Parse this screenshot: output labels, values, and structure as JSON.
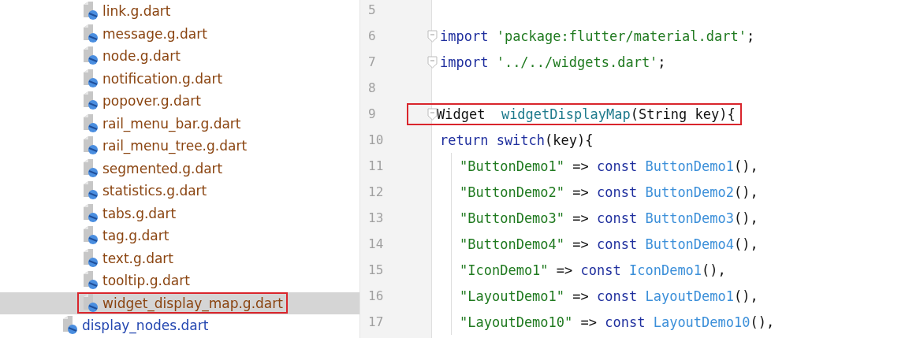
{
  "project_tree": [
    {
      "children": [
        {
          "label": "link.g.dart",
          "kind": "generated",
          "selected": false
        },
        {
          "label": "message.g.dart",
          "kind": "generated",
          "selected": false
        },
        {
          "label": "node.g.dart",
          "kind": "generated",
          "selected": false
        },
        {
          "label": "notification.g.dart",
          "kind": "generated",
          "selected": false
        },
        {
          "label": "popover.g.dart",
          "kind": "generated",
          "selected": false
        },
        {
          "label": "rail_menu_bar.g.dart",
          "kind": "generated",
          "selected": false
        },
        {
          "label": "rail_menu_tree.g.dart",
          "kind": "generated",
          "selected": false
        },
        {
          "label": "segmented.g.dart",
          "kind": "generated",
          "selected": false
        },
        {
          "label": "statistics.g.dart",
          "kind": "generated",
          "selected": false
        },
        {
          "label": "tabs.g.dart",
          "kind": "generated",
          "selected": false
        },
        {
          "label": "tag.g.dart",
          "kind": "generated",
          "selected": false
        },
        {
          "label": "text.g.dart",
          "kind": "generated",
          "selected": false
        },
        {
          "label": "tooltip.g.dart",
          "kind": "generated",
          "selected": false
        },
        {
          "label": "widget_display_map.g.dart",
          "kind": "generated",
          "selected": true,
          "boxed": true
        }
      ]
    },
    {
      "label": "display_nodes.dart",
      "kind": "source",
      "selected": false
    }
  ],
  "editor": {
    "lines": [
      {
        "number": "5"
      },
      {
        "number": "6",
        "fold": true,
        "tokens": [
          {
            "kind": "keyword",
            "text": "import "
          },
          {
            "kind": "string",
            "text": "'package:flutter/material.dart'"
          },
          {
            "kind": "plain",
            "text": ";"
          }
        ]
      },
      {
        "number": "7",
        "fold": true,
        "tokens": [
          {
            "kind": "keyword",
            "text": "import "
          },
          {
            "kind": "string",
            "text": "'../../widgets.dart'"
          },
          {
            "kind": "plain",
            "text": ";"
          }
        ]
      },
      {
        "number": "8"
      },
      {
        "number": "9",
        "fold": true,
        "boxed": true,
        "tokens": [
          {
            "kind": "plain",
            "text": "Widget  "
          },
          {
            "kind": "function",
            "text": "widgetDisplayMap"
          },
          {
            "kind": "plain",
            "text": "(String key){"
          }
        ]
      },
      {
        "number": "10",
        "tokens": [
          {
            "kind": "keyword",
            "text": "return switch"
          },
          {
            "kind": "plain",
            "text": "(key){"
          }
        ],
        "children": [
          {
            "number": "11",
            "tokens": [
              {
                "kind": "string",
                "text": "\"ButtonDemo1\""
              },
              {
                "kind": "plain",
                "text": " => "
              },
              {
                "kind": "keyword",
                "text": "const "
              },
              {
                "kind": "class",
                "text": "ButtonDemo1"
              },
              {
                "kind": "plain",
                "text": "(),"
              }
            ]
          },
          {
            "number": "12",
            "tokens": [
              {
                "kind": "string",
                "text": "\"ButtonDemo2\""
              },
              {
                "kind": "plain",
                "text": " => "
              },
              {
                "kind": "keyword",
                "text": "const "
              },
              {
                "kind": "class",
                "text": "ButtonDemo2"
              },
              {
                "kind": "plain",
                "text": "(),"
              }
            ]
          },
          {
            "number": "13",
            "tokens": [
              {
                "kind": "string",
                "text": "\"ButtonDemo3\""
              },
              {
                "kind": "plain",
                "text": " => "
              },
              {
                "kind": "keyword",
                "text": "const "
              },
              {
                "kind": "class",
                "text": "ButtonDemo3"
              },
              {
                "kind": "plain",
                "text": "(),"
              }
            ]
          },
          {
            "number": "14",
            "tokens": [
              {
                "kind": "string",
                "text": "\"ButtonDemo4\""
              },
              {
                "kind": "plain",
                "text": " => "
              },
              {
                "kind": "keyword",
                "text": "const "
              },
              {
                "kind": "class",
                "text": "ButtonDemo4"
              },
              {
                "kind": "plain",
                "text": "(),"
              }
            ]
          },
          {
            "number": "15",
            "tokens": [
              {
                "kind": "string",
                "text": "\"IconDemo1\""
              },
              {
                "kind": "plain",
                "text": " => "
              },
              {
                "kind": "keyword",
                "text": "const "
              },
              {
                "kind": "class",
                "text": "IconDemo1"
              },
              {
                "kind": "plain",
                "text": "(),"
              }
            ]
          },
          {
            "number": "16",
            "tokens": [
              {
                "kind": "string",
                "text": "\"LayoutDemo1\""
              },
              {
                "kind": "plain",
                "text": " => "
              },
              {
                "kind": "keyword",
                "text": "const "
              },
              {
                "kind": "class",
                "text": "LayoutDemo1"
              },
              {
                "kind": "plain",
                "text": "(),"
              }
            ]
          },
          {
            "number": "17",
            "tokens": [
              {
                "kind": "string",
                "text": "\"LayoutDemo10\""
              },
              {
                "kind": "plain",
                "text": " => "
              },
              {
                "kind": "keyword",
                "text": "const "
              },
              {
                "kind": "class",
                "text": "LayoutDemo10"
              },
              {
                "kind": "plain",
                "text": "(),"
              }
            ]
          }
        ]
      }
    ]
  }
}
